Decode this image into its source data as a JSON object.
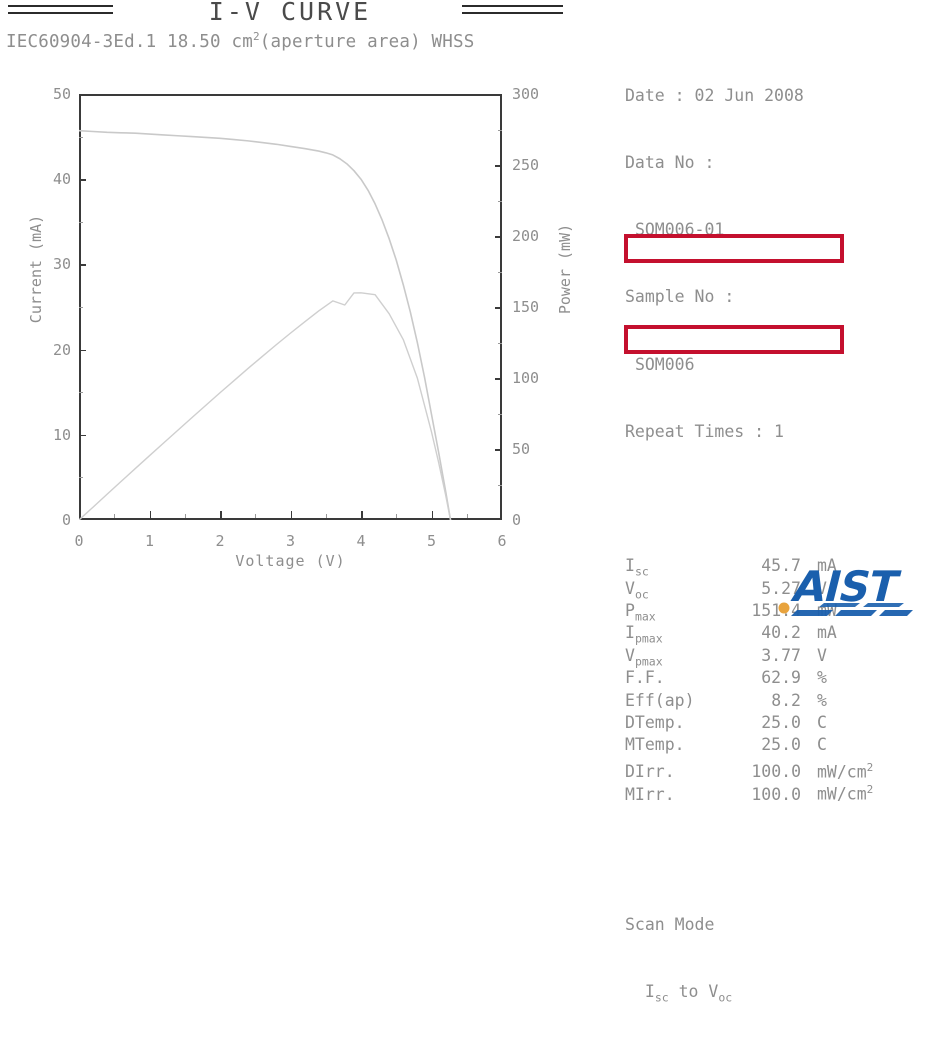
{
  "header": {
    "title": "I-V CURVE",
    "standard": "IEC60904-3Ed.1 18.50 cm",
    "standard_sup": "2",
    "standard_tail": "(aperture area) WHSS",
    "rule_left": "divider",
    "rule_right": "divider"
  },
  "axes": {
    "x_title": "Voltage (V)",
    "y_left_title": "Current (mA)",
    "y_right_title": "Power (mW)",
    "x_ticks": [
      "0",
      "1",
      "2",
      "3",
      "4",
      "5",
      "6"
    ],
    "y_left_ticks": [
      "0",
      "10",
      "20",
      "30",
      "40",
      "50"
    ],
    "y_right_ticks": [
      "0",
      "50",
      "100",
      "150",
      "200",
      "250",
      "300"
    ]
  },
  "info": {
    "date_label": "Date :",
    "date_value": "02 Jun 2008",
    "data_no_label": "Data No :",
    "data_no_value": "SOM006-01",
    "sample_no_label": "Sample No :",
    "sample_no_value": "SOM006",
    "repeat_label": "Repeat Times :",
    "repeat_value": "1",
    "scan_mode_label": "Scan Mode",
    "scan_mode_value_a": "I",
    "scan_mode_value_a_sub": "sc",
    "scan_mode_value_mid": " to V",
    "scan_mode_value_b_sub": "oc"
  },
  "params": [
    {
      "key": "I",
      "key_sub": "sc",
      "value": "45.7",
      "unit": "mA",
      "highlight": false
    },
    {
      "key": "V",
      "key_sub": "oc",
      "value": "5.27",
      "unit": "V",
      "highlight": false
    },
    {
      "key": "P",
      "key_sub": "max",
      "value": "151.4",
      "unit": "mW",
      "highlight": true
    },
    {
      "key": "I",
      "key_sub": "pmax",
      "value": "40.2",
      "unit": "mA",
      "highlight": false
    },
    {
      "key": "V",
      "key_sub": "pmax",
      "value": "3.77",
      "unit": "V",
      "highlight": false
    },
    {
      "key": "F.F.",
      "key_sub": "",
      "value": "62.9",
      "unit": "%",
      "highlight": false
    },
    {
      "key": "Eff(ap)",
      "key_sub": "",
      "value": "8.2",
      "unit": "%",
      "highlight": true
    },
    {
      "key": "DTemp.",
      "key_sub": "",
      "value": "25.0",
      "unit": "C",
      "highlight": false
    },
    {
      "key": "MTemp.",
      "key_sub": "",
      "value": "25.0",
      "unit": "C",
      "highlight": false
    },
    {
      "key": "DIrr.",
      "key_sub": "",
      "value": "100.0",
      "unit": "mW/cm2",
      "highlight": false
    },
    {
      "key": "MIrr.",
      "key_sub": "",
      "value": "100.0",
      "unit": "mW/cm2",
      "highlight": false
    }
  ],
  "colors": {
    "highlight": "#c4102e",
    "logo_blue": "#1a5fad",
    "logo_dot": "#e8a33d",
    "curve": "#c9c9c9",
    "axis": "#3a3a3a",
    "text": "#8e8e8e"
  },
  "logo": {
    "text": "AIST",
    "dot": "dot"
  },
  "chart_data": {
    "type": "line",
    "title": "I-V CURVE",
    "xlabel": "Voltage (V)",
    "ylabel": "Current (mA)",
    "y2label": "Power (mW)",
    "xlim": [
      0,
      6
    ],
    "ylim": [
      0,
      50
    ],
    "y2lim": [
      0,
      300
    ],
    "grid": false,
    "legend": "none",
    "series": [
      {
        "name": "Current (mA)",
        "axis": "left",
        "x": [
          0.0,
          0.2,
          0.4,
          0.6,
          0.8,
          1.0,
          1.2,
          1.4,
          1.6,
          1.8,
          2.0,
          2.2,
          2.4,
          2.6,
          2.8,
          3.0,
          3.2,
          3.4,
          3.5,
          3.6,
          3.7,
          3.8,
          3.9,
          4.0,
          4.1,
          4.2,
          4.3,
          4.4,
          4.5,
          4.6,
          4.7,
          4.8,
          4.9,
          5.0,
          5.1,
          5.2,
          5.27
        ],
        "values": [
          45.7,
          45.6,
          45.5,
          45.45,
          45.4,
          45.3,
          45.2,
          45.1,
          45.0,
          44.9,
          44.8,
          44.65,
          44.5,
          44.3,
          44.1,
          43.85,
          43.6,
          43.3,
          43.1,
          42.85,
          42.4,
          41.8,
          41.0,
          40.0,
          38.7,
          37.1,
          35.2,
          33.0,
          30.5,
          27.6,
          24.4,
          20.8,
          16.8,
          12.4,
          8.0,
          3.4,
          0.0
        ]
      },
      {
        "name": "Power (mW)",
        "axis": "right",
        "x": [
          0.0,
          0.2,
          0.4,
          0.6,
          0.8,
          1.0,
          1.2,
          1.4,
          1.6,
          1.8,
          2.0,
          2.2,
          2.4,
          2.6,
          2.8,
          3.0,
          3.2,
          3.4,
          3.6,
          3.77,
          3.9,
          4.0,
          4.2,
          4.4,
          4.6,
          4.8,
          5.0,
          5.1,
          5.2,
          5.27
        ],
        "values": [
          0.0,
          9.1,
          18.2,
          27.3,
          36.3,
          45.3,
          54.2,
          63.1,
          72.0,
          80.8,
          89.6,
          98.2,
          106.8,
          115.2,
          123.5,
          131.6,
          139.5,
          147.2,
          154.3,
          151.4,
          159.9,
          160.0,
          158.7,
          145.2,
          127.0,
          99.8,
          62.0,
          40.8,
          17.7,
          0.0
        ]
      }
    ]
  }
}
